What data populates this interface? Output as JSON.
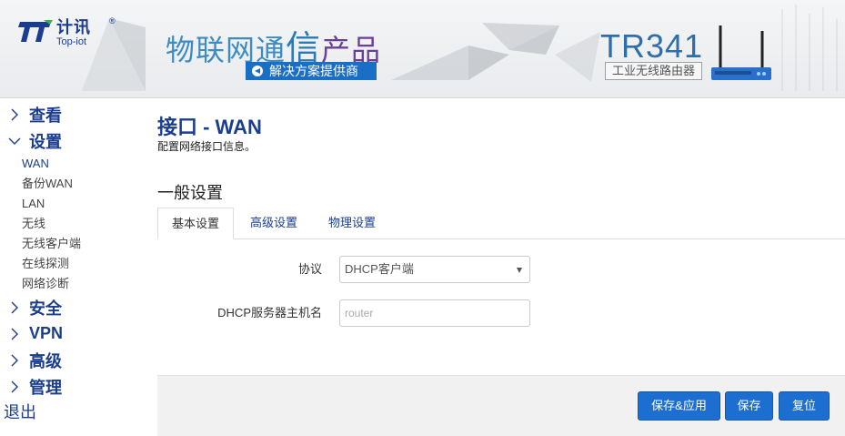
{
  "header": {
    "logo_cn": "计讯",
    "logo_en": "Top-iot",
    "logo_reg": "®",
    "slogan_1": "物联网通",
    "slogan_2": "信",
    "slogan_3": "产品",
    "sub_slogan": "解决方案提供商",
    "model": "TR341",
    "model_sub": "工业无线路由器"
  },
  "sidebar": {
    "items": [
      {
        "label": "查看",
        "expanded": false
      },
      {
        "label": "设置",
        "expanded": true
      }
    ],
    "sub_items": [
      "WAN",
      "备份WAN",
      "LAN",
      "无线",
      "无线客户端",
      "在线探测",
      "网络诊断"
    ],
    "items_after": [
      {
        "label": "安全"
      },
      {
        "label": "VPN"
      },
      {
        "label": "高级"
      },
      {
        "label": "管理"
      }
    ],
    "logout": "退出"
  },
  "main": {
    "title": "接口 - WAN",
    "description": "配置网络接口信息。",
    "section_title": "一般设置",
    "tabs": [
      "基本设置",
      "高级设置",
      "物理设置"
    ],
    "active_tab": "基本设置",
    "protocol_label": "协议",
    "protocol_value": "DHCP客户端",
    "hostname_label": "DHCP服务器主机名",
    "hostname_placeholder": "router",
    "buttons": {
      "save_apply": "保存&应用",
      "save": "保存",
      "reset": "复位"
    }
  },
  "colors": {
    "accent": "#1b3d8f",
    "button": "#1c6fd1",
    "slogan_blue": "#3d8cc3"
  }
}
